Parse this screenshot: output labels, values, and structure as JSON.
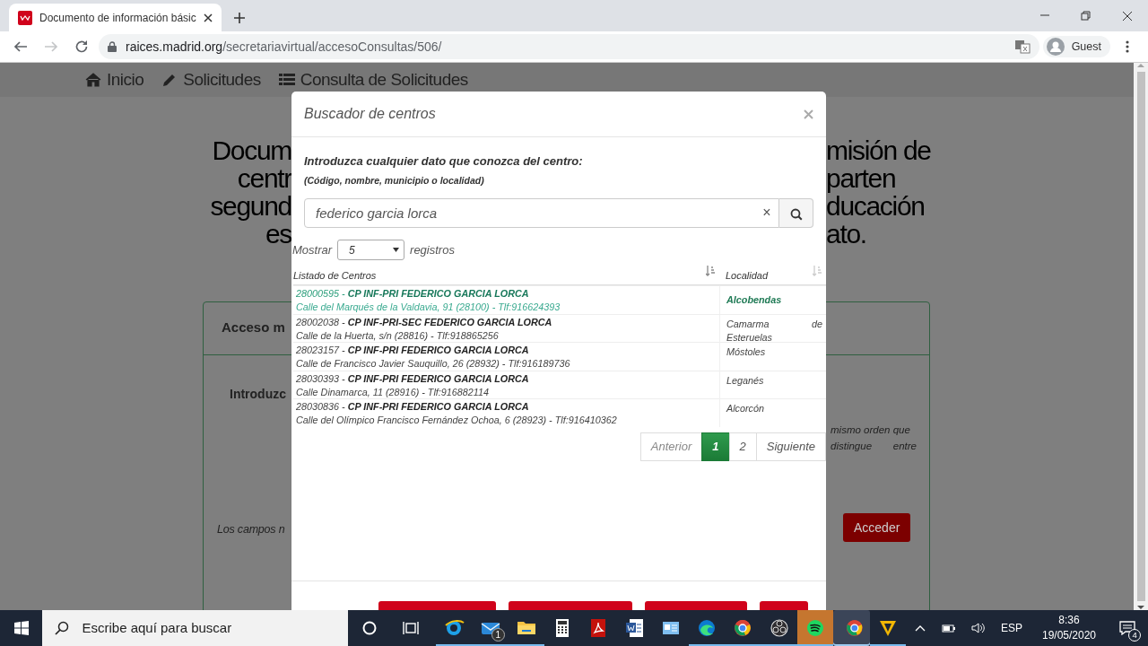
{
  "browser": {
    "tab": {
      "title": "Documento de información básic"
    },
    "url_host": "raices.madrid.org",
    "url_path": "/secretariavirtual/accesoConsultas/506/",
    "forward_disabled": true,
    "profile": "Guest"
  },
  "page": {
    "nav": [
      {
        "kind": "home",
        "label": "Inicio"
      },
      {
        "kind": "pencil",
        "label": "Solicitudes"
      },
      {
        "kind": "list",
        "label": "Consulta de Solicitudes"
      }
    ],
    "heading_left": [
      "Docum",
      "centr",
      "segund",
      "es"
    ],
    "heading_right": [
      "misión de",
      "parten",
      "ducación",
      "ato."
    ],
    "card_title": "Acceso m",
    "card_prompt": "Introduzc",
    "card_text_right": [
      "mismo orden que",
      "distingue entre"
    ],
    "footer_note": "Los campos n",
    "submit": "Acceder"
  },
  "modal": {
    "title": "Buscador de centros",
    "prompt": "Introduzca cualquier dato que conozca del centro:",
    "hint": "(Código, nombre, municipio o localidad)",
    "search_value": "federico garcia lorca",
    "clear": "×",
    "show_label": "Mostrar",
    "page_size": "5",
    "records_label": "registros",
    "columns": [
      "Listado de Centros",
      "Localidad"
    ],
    "rows": [
      {
        "title": "28000595 - **CP INF-PRI FEDERICO GARCIA LORCA**",
        "address": "Calle del Marqués de la Valdavia, 91 (28100) - Tlf:916624393",
        "locality": "Alcobendas",
        "highlighted": true
      },
      {
        "title": "28002038 - **CP INF-PRI-SEC FEDERICO GARCIA LORCA**",
        "address": "Calle de la Huerta, s/n (28816) - Tlf:918865256",
        "locality": "Camarma de Esteruelas",
        "highlighted": false
      },
      {
        "title": "28023157 - **CP INF-PRI FEDERICO GARCIA LORCA**",
        "address": "Calle de Francisco Javier Sauquillo, 26 (28932) - Tlf:916189736",
        "locality": "Móstoles",
        "highlighted": false
      },
      {
        "title": "28030393 - **CP INF-PRI FEDERICO GARCIA LORCA**",
        "address": "Calle Dinamarca, 11 (28916) - Tlf:916882114",
        "locality": "Leganés",
        "highlighted": false
      },
      {
        "title": "28030836 - **CP INF-PRI FEDERICO GARCIA LORCA**",
        "address": "Calle del Olímpico Francisco Fernández Ochoa, 6 (28923) - Tlf:916410362",
        "locality": "Alcorcón",
        "highlighted": false
      }
    ],
    "pagination": [
      {
        "label": "Anterior",
        "selected": false,
        "disabled": true
      },
      {
        "label": "1",
        "selected": true,
        "disabled": false
      },
      {
        "label": "2",
        "selected": false,
        "disabled": false
      },
      {
        "label": "Siguiente",
        "selected": false,
        "disabled": false
      }
    ],
    "footer_buttons": [
      {
        "kind": "danger"
      },
      {
        "kind": "danger"
      },
      {
        "kind": "danger"
      },
      {
        "kind": "danger"
      }
    ]
  },
  "taskbar": {
    "search_placeholder": "Escribe aquí para buscar",
    "apps": [
      {
        "kind": "globe",
        "open": true,
        "selected": false,
        "alert": false
      },
      {
        "kind": "mail",
        "open": true,
        "selected": false,
        "alert": false,
        "badge": "1"
      },
      {
        "kind": "folder",
        "open": true,
        "selected": false,
        "alert": false
      },
      {
        "kind": "calculator",
        "open": false,
        "selected": false,
        "alert": false
      },
      {
        "kind": "pdf",
        "open": false,
        "selected": false,
        "alert": false
      },
      {
        "kind": "document",
        "open": false,
        "selected": false,
        "alert": false
      },
      {
        "kind": "card",
        "open": false,
        "selected": false,
        "alert": false
      },
      {
        "kind": "wave",
        "open": true,
        "selected": false,
        "alert": false
      },
      {
        "kind": "wheel",
        "open": true,
        "selected": false,
        "alert": false
      },
      {
        "kind": "aperture",
        "open": true,
        "selected": false,
        "alert": false
      },
      {
        "kind": "music",
        "open": true,
        "selected": false,
        "alert": true
      },
      {
        "kind": "wheel",
        "open": true,
        "selected": true,
        "alert": false
      },
      {
        "kind": "chevron",
        "open": true,
        "selected": false,
        "alert": false
      }
    ],
    "language": "ESP",
    "time": "8:36",
    "date": "19/05/2020",
    "notifications": "4"
  }
}
